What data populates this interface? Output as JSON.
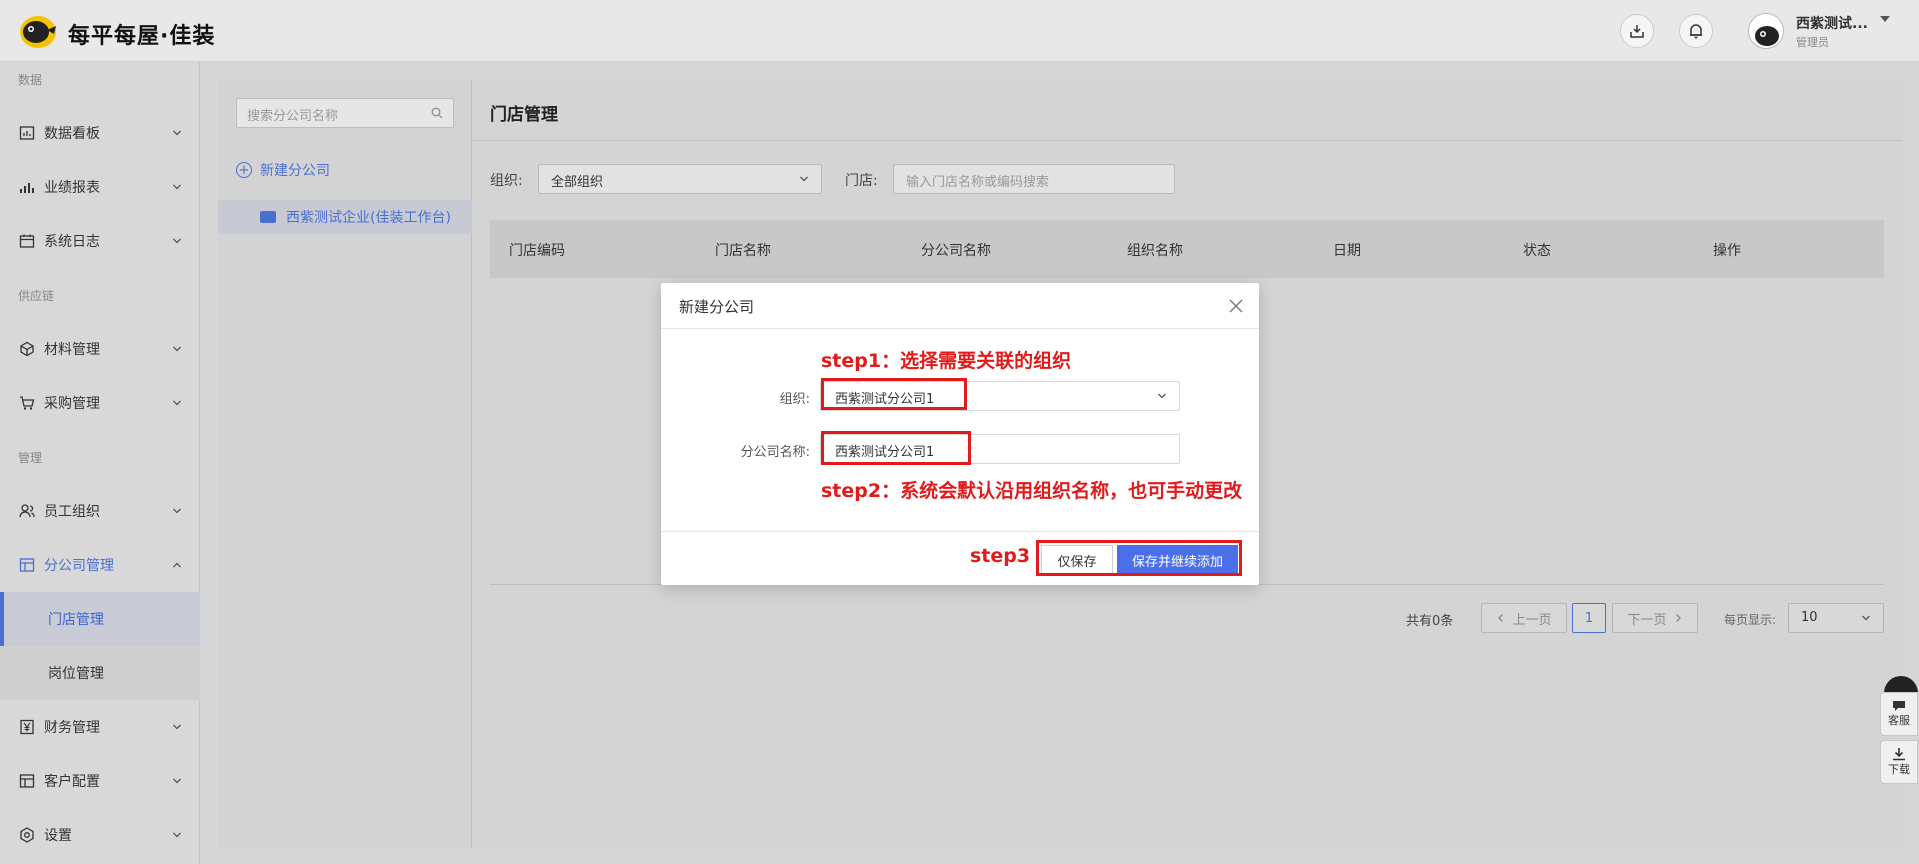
{
  "header": {
    "brand": "每平每屋·佳装",
    "user_name": "西紫测试...",
    "user_role": "管理员"
  },
  "sidebar": {
    "sections": {
      "data": "数据",
      "supply": "供应链",
      "manage": "管理"
    },
    "items": [
      {
        "label": "数据看板",
        "icon": "dashboard-icon"
      },
      {
        "label": "业绩报表",
        "icon": "bar-chart-icon"
      },
      {
        "label": "系统日志",
        "icon": "calendar-icon"
      },
      {
        "label": "材料管理",
        "icon": "box-icon"
      },
      {
        "label": "采购管理",
        "icon": "cart-icon"
      },
      {
        "label": "员工组织",
        "icon": "users-icon"
      },
      {
        "label": "分公司管理",
        "icon": "building-icon"
      },
      {
        "label": "财务管理",
        "icon": "yen-icon"
      },
      {
        "label": "客户配置",
        "icon": "table-icon"
      },
      {
        "label": "设置",
        "icon": "gear-icon"
      }
    ],
    "sub_items": [
      {
        "label": "门店管理"
      },
      {
        "label": "岗位管理"
      }
    ]
  },
  "tree": {
    "search_placeholder": "搜索分公司名称",
    "new_branch": "新建分公司",
    "node": "西紫测试企业(佳装工作台)"
  },
  "content": {
    "title": "门店管理",
    "org_label": "组织:",
    "org_value": "全部组织",
    "store_label": "门店:",
    "store_placeholder": "输入门店名称或编码搜索",
    "columns": [
      "门店编码",
      "门店名称",
      "分公司名称",
      "组织名称",
      "日期",
      "状态",
      "操作"
    ]
  },
  "pager": {
    "total": "共有0条",
    "prev": "上一页",
    "current": "1",
    "next": "下一页",
    "size_label": "每页显示:",
    "size": "10"
  },
  "float": {
    "service": "客服",
    "download": "下载"
  },
  "modal": {
    "title": "新建分公司",
    "org_label": "组织:",
    "org_value": "西紫测试分公司1",
    "name_label": "分公司名称:",
    "name_value": "西紫测试分公司1",
    "btn_save": "仅保存",
    "btn_save_continue": "保存并继续添加"
  },
  "annotations": {
    "step1": "step1：选择需要关联的组织",
    "step2": "step2：系统会默认沿用组织名称，也可手动更改",
    "step3": "step3",
    "color": "#e31a1a"
  }
}
